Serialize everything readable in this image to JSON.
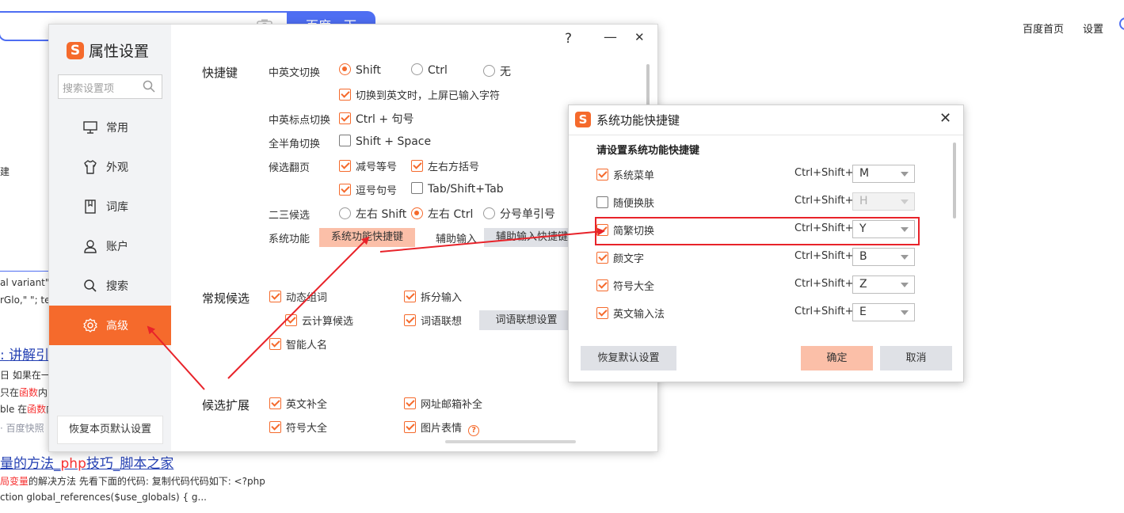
{
  "background": {
    "search_button": "百度一下",
    "nav": [
      "百度首页",
      "设置"
    ],
    "fragments": {
      "left_jian": "建",
      "code1": "al variant\":/",
      "code2": "rGlo,\" \"; te",
      "link1": "讲解引",
      "line_date": "日 如果在一",
      "line_func1_pre": "只在",
      "line_func1_red": "函数",
      "line_func1_post": "内",
      "line_func2_pre": "ble 在",
      "line_func2_red": "函数",
      "line_func2_post": "内",
      "kuaizhao": "百度快照",
      "link2_pre": "量的方法_",
      "link2_red": "php",
      "link2_post": "技巧_脚本之家",
      "snippet1_red": "局变量",
      "snippet1_post": "的解决方法 先看下面的代码: 复制代码代码如下: <?php",
      "snippet2": "ction global_references($use_globals) { g..."
    }
  },
  "settings": {
    "title": "属性设置",
    "logo_char": "S",
    "search_placeholder": "搜索设置项",
    "titlebar": {
      "help": "?",
      "minimize": "—",
      "close": "✕"
    },
    "sidebar": [
      {
        "label": "常用",
        "icon": "monitor-icon"
      },
      {
        "label": "外观",
        "icon": "shirt-icon"
      },
      {
        "label": "词库",
        "icon": "book-icon"
      },
      {
        "label": "账户",
        "icon": "user-icon"
      },
      {
        "label": "搜索",
        "icon": "search-icon"
      },
      {
        "label": "高级",
        "icon": "gear-icon",
        "active": true
      }
    ],
    "reset_page": "恢复本页默认设置",
    "shortcuts": {
      "section": "快捷键",
      "cn_en_label": "中英文切换",
      "cn_en_options": [
        "Shift",
        "Ctrl",
        "无"
      ],
      "cn_en_selected": "Shift",
      "switch_commit": "切换到英文时，上屏已输入字符",
      "punct_label": "中英标点切换",
      "punct_value": "Ctrl + 句号",
      "width_label": "全半角切换",
      "width_value": "Shift + Space",
      "page_label": "候选翻页",
      "page_options": [
        "减号等号",
        "左右方括号",
        "逗号句号",
        "Tab/Shift+Tab"
      ],
      "page_checked": [
        true,
        true,
        true,
        false
      ],
      "select23_label": "二三候选",
      "select23_options": [
        "左右 Shift",
        "左右 Ctrl",
        "分号单引号"
      ],
      "select23_selected": "左右 Ctrl",
      "sysfunc_label": "系统功能",
      "sysfunc_button": "系统功能快捷键",
      "aux_label": "辅助输入",
      "aux_button": "辅助输入快捷键"
    },
    "candidates": {
      "section": "常规候选",
      "dynamic_words": "动态组词",
      "split_input": "拆分输入",
      "cloud": "云计算候选",
      "word_assoc": "词语联想",
      "word_assoc_button": "词语联想设置",
      "smart_names": "智能人名"
    },
    "extend": {
      "section": "候选扩展",
      "english": "英文补全",
      "url_email": "网址邮箱补全",
      "symbols": "符号大全",
      "emoji": "图片表情"
    }
  },
  "dialog": {
    "title": "系统功能快捷键",
    "subtitle": "请设置系统功能快捷键",
    "close": "✕",
    "prefix": "Ctrl+Shift+",
    "items": [
      {
        "name": "系统菜单",
        "checked": true,
        "key": "M"
      },
      {
        "name": "随便换肤",
        "checked": false,
        "key": "H"
      },
      {
        "name": "简繁切换",
        "checked": true,
        "key": "Y",
        "highlighted": true
      },
      {
        "name": "颜文字",
        "checked": true,
        "key": "B"
      },
      {
        "name": "符号大全",
        "checked": true,
        "key": "Z"
      },
      {
        "name": "英文输入法",
        "checked": true,
        "key": "E"
      }
    ],
    "reset_button": "恢复默认设置",
    "ok_button": "确定",
    "cancel_button": "取消"
  },
  "colors": {
    "accent": "#f56a2c",
    "accent_light": "#fbbfa8",
    "annotation_red": "#e8232a",
    "baidu_blue": "#4e6ef2"
  }
}
